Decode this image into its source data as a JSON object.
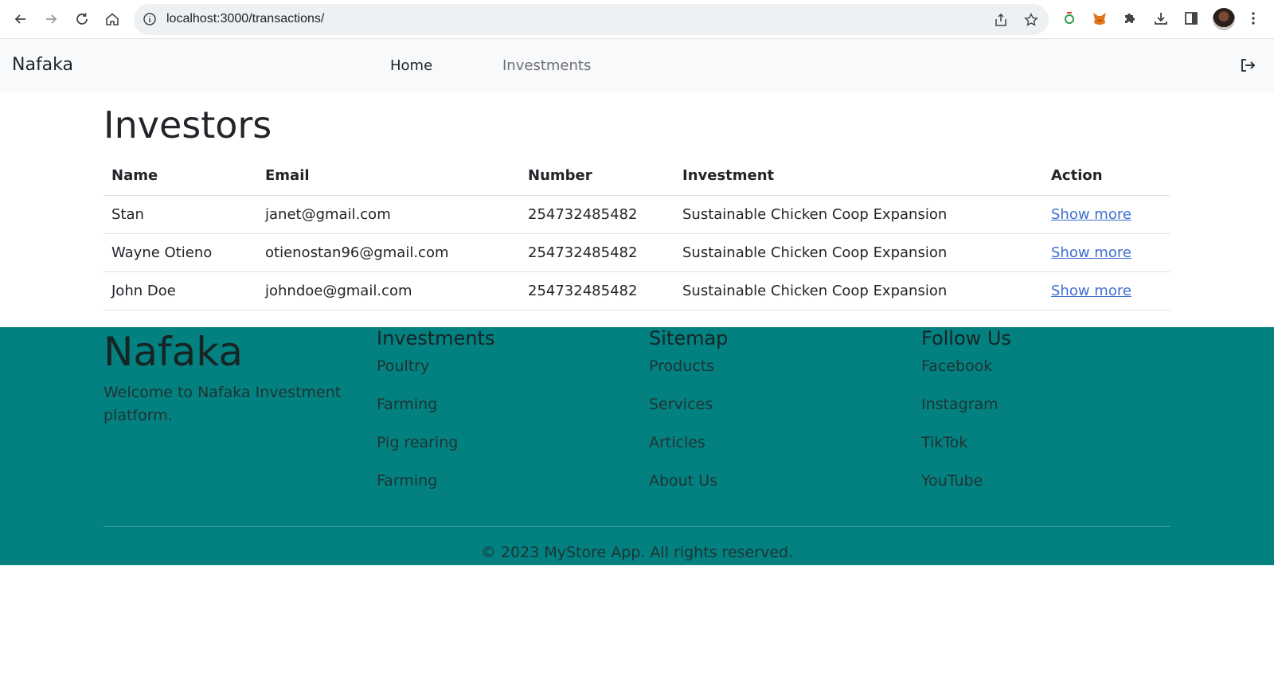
{
  "browser": {
    "url": "localhost:3000/transactions/"
  },
  "navbar": {
    "brand": "Nafaka",
    "links": [
      {
        "label": "Home",
        "active": true
      },
      {
        "label": "Investments",
        "active": false
      }
    ]
  },
  "main": {
    "title": "Investors",
    "table": {
      "headers": [
        "Name",
        "Email",
        "Number",
        "Investment",
        "Action"
      ],
      "rows": [
        {
          "name": "Stan",
          "email": "janet@gmail.com",
          "number": "254732485482",
          "investment": "Sustainable Chicken Coop Expansion",
          "action": "Show more"
        },
        {
          "name": "Wayne Otieno",
          "email": "otienostan96@gmail.com",
          "number": "254732485482",
          "investment": "Sustainable Chicken Coop Expansion",
          "action": "Show more"
        },
        {
          "name": "John Doe",
          "email": "johndoe@gmail.com",
          "number": "254732485482",
          "investment": "Sustainable Chicken Coop Expansion",
          "action": "Show more"
        }
      ]
    }
  },
  "footer": {
    "brand": "Nafaka",
    "welcome": "Welcome to Nafaka Investment platform.",
    "columns": [
      {
        "title": "Investments",
        "items": [
          "Poultry",
          "Farming",
          "Pig rearing",
          "Farming"
        ]
      },
      {
        "title": "Sitemap",
        "items": [
          "Products",
          "Services",
          "Articles",
          "About Us"
        ]
      },
      {
        "title": "Follow Us",
        "items": [
          "Facebook",
          "Instagram",
          "TikTok",
          "YouTube"
        ]
      }
    ],
    "copyright": "© 2023 MyStore App. All rights reserved."
  },
  "colors": {
    "footer_bg": "#038080",
    "link": "#3f6fcf",
    "navbar_bg": "#f8f9fa"
  }
}
